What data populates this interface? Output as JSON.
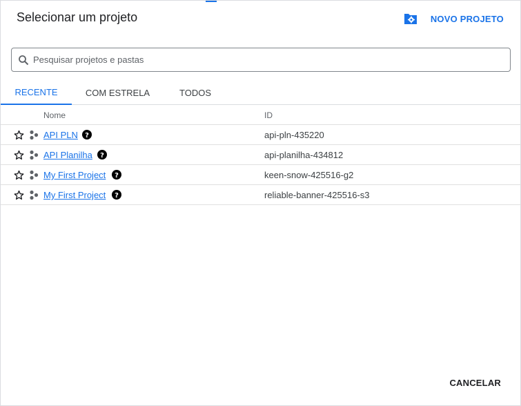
{
  "dialog": {
    "title": "Selecionar um projeto",
    "new_project_label": "NOVO PROJETO",
    "cancel_label": "CANCELAR"
  },
  "search": {
    "placeholder": "Pesquisar projetos e pastas",
    "value": ""
  },
  "tabs": [
    {
      "label": "RECENTE",
      "active": true
    },
    {
      "label": "COM ESTRELA",
      "active": false
    },
    {
      "label": "TODOS",
      "active": false
    }
  ],
  "table": {
    "columns": [
      "Nome",
      "ID"
    ],
    "rows": [
      {
        "name": "API PLN",
        "id": "api-pln-435220"
      },
      {
        "name": "API Planilha",
        "id": "api-planilha-434812"
      },
      {
        "name": "My First Project",
        "id": "keen-snow-425516-g2"
      },
      {
        "name": "My First Project",
        "id": "reliable-banner-425516-s3"
      }
    ]
  },
  "icons": {
    "new_project": "folder-settings-icon",
    "search": "search-icon",
    "star": "star-outline-icon",
    "project": "project-hub-icon",
    "help": "help-circle-icon"
  },
  "colors": {
    "accent": "#1a73e8",
    "text": "#202124",
    "muted": "#5f6368",
    "divider": "#e0e0e0"
  }
}
